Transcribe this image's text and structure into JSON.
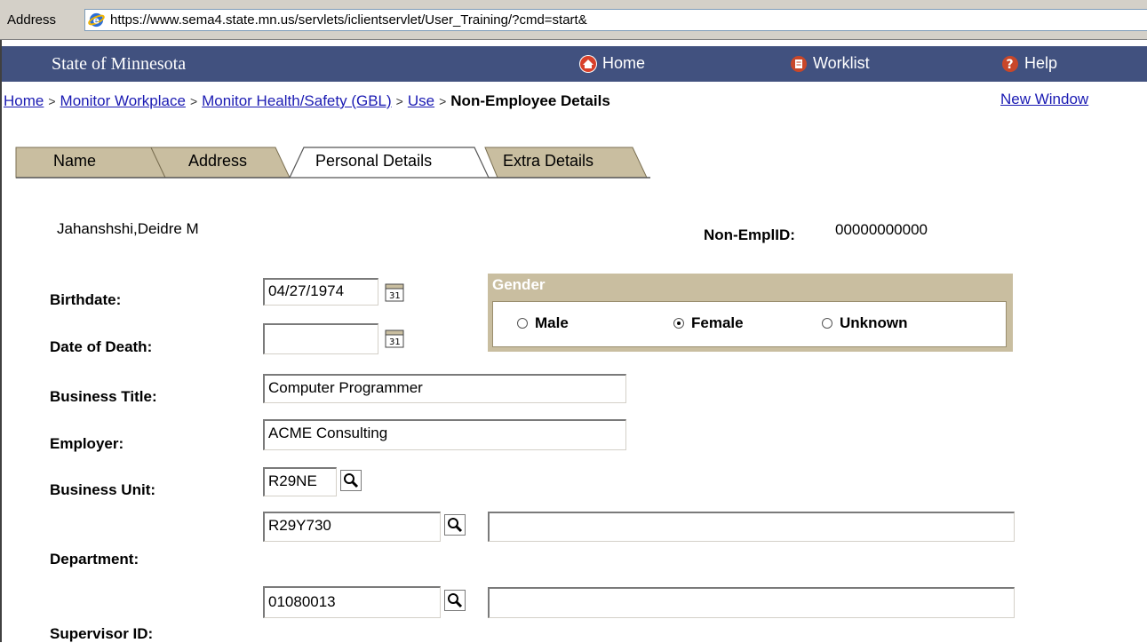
{
  "browser": {
    "address_label": "Address",
    "url": "https://www.sema4.state.mn.us/servlets/iclientservlet/User_Training/?cmd=start&"
  },
  "header": {
    "site_name": "State of Minnesota",
    "home_label": "Home",
    "worklist_label": "Worklist",
    "help_label": "Help"
  },
  "breadcrumb": {
    "items": [
      "Home",
      "Monitor Workplace",
      "Monitor Health/Safety (GBL)",
      "Use"
    ],
    "separator": ">",
    "current": "Non-Employee Details",
    "new_window": "New Window"
  },
  "tabs": [
    {
      "label": "Name",
      "selected": false
    },
    {
      "label": "Address",
      "selected": false
    },
    {
      "label": "Personal Details",
      "selected": true
    },
    {
      "label": "Extra Details",
      "selected": false
    }
  ],
  "person": {
    "name": "Jahanshshi,Deidre M",
    "nonemplid_label": "Non-EmplID:",
    "nonemplid_value": "00000000000"
  },
  "form": {
    "birthdate_label": "Birthdate:",
    "birthdate_value": "04/27/1974",
    "date_of_death_label": "Date of Death:",
    "date_of_death_value": "",
    "business_title_label": "Business Title:",
    "business_title_value": "Computer Programmer",
    "employer_label": "Employer:",
    "employer_value": "ACME Consulting",
    "business_unit_label": "Business Unit:",
    "business_unit_value": "R29NE",
    "department_label": "Department:",
    "department_value": "R29Y730",
    "department_desc": "",
    "supervisor_label": "Supervisor ID:",
    "supervisor_value": "01080013",
    "supervisor_desc": ""
  },
  "gender": {
    "title": "Gender",
    "options": [
      "Male",
      "Female",
      "Unknown"
    ],
    "selected": "Female"
  },
  "colors": {
    "header_bg": "#41517f",
    "tab_bg": "#c9bea0",
    "link": "#1b1bb3"
  }
}
